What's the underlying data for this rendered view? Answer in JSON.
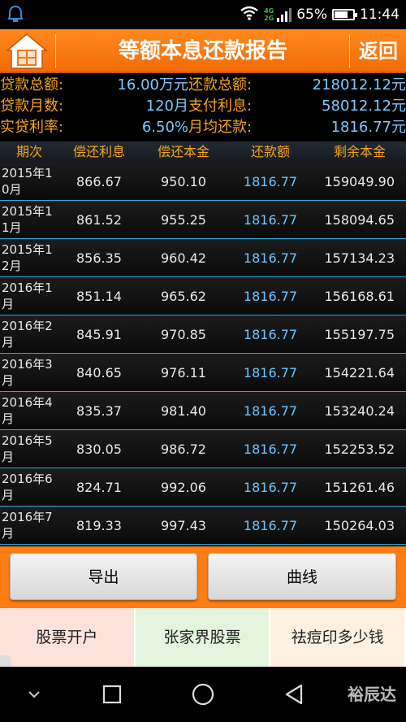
{
  "status_bar": {
    "network": [
      "4G",
      "2G"
    ],
    "battery": "65%",
    "time": "11:44"
  },
  "header": {
    "title": "等额本息还款报告",
    "back_label": "返回"
  },
  "summary": [
    {
      "label1": "贷款总额:",
      "value1": "16.00万元",
      "label2": "还款总额:",
      "value2": "218012.12元"
    },
    {
      "label1": "贷款月数:",
      "value1": "120月",
      "label2": "支付利息:",
      "value2": "58012.12元"
    },
    {
      "label1": "实贷利率:",
      "value1": "6.50%",
      "label2": "月均还款:",
      "value2": "1816.77元"
    }
  ],
  "table": {
    "headers": [
      "期次",
      "偿还利息",
      "偿还本金",
      "还款额",
      "剩余本金"
    ],
    "rows": [
      [
        "2015年10月",
        "866.67",
        "950.10",
        "1816.77",
        "159049.90"
      ],
      [
        "2015年11月",
        "861.52",
        "955.25",
        "1816.77",
        "158094.65"
      ],
      [
        "2015年12月",
        "856.35",
        "960.42",
        "1816.77",
        "157134.23"
      ],
      [
        "2016年1月",
        "851.14",
        "965.62",
        "1816.77",
        "156168.61"
      ],
      [
        "2016年2月",
        "845.91",
        "970.85",
        "1816.77",
        "155197.75"
      ],
      [
        "2016年3月",
        "840.65",
        "976.11",
        "1816.77",
        "154221.64"
      ],
      [
        "2016年4月",
        "835.37",
        "981.40",
        "1816.77",
        "153240.24"
      ],
      [
        "2016年5月",
        "830.05",
        "986.72",
        "1816.77",
        "152253.52"
      ],
      [
        "2016年6月",
        "824.71",
        "992.06",
        "1816.77",
        "151261.46"
      ],
      [
        "2016年7月",
        "819.33",
        "997.43",
        "1816.77",
        "150264.03"
      ]
    ]
  },
  "actions": {
    "export_label": "导出",
    "curve_label": "曲线"
  },
  "ads": [
    "股票开户",
    "张家界股票",
    "祛痘印多少钱"
  ],
  "ad_colors": [
    "#fde3dc",
    "#e3f5df",
    "#fff1e0"
  ],
  "watermark": "裕辰达"
}
